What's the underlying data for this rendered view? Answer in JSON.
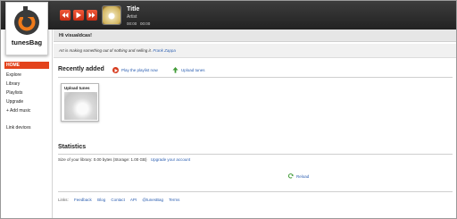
{
  "app": {
    "name": "tunesBag"
  },
  "player": {
    "title": "Title",
    "artist": "Artist",
    "time_elapsed": "00:00",
    "time_total": "00:00",
    "controls": [
      "previous",
      "play",
      "next"
    ]
  },
  "sidebar": {
    "items": [
      {
        "label": "HOME",
        "active": true
      },
      {
        "label": "Explore"
      },
      {
        "label": "Library"
      },
      {
        "label": "Playlists"
      },
      {
        "label": "Upgrade"
      },
      {
        "label": "+ Add music"
      },
      {
        "label": "Link devices"
      }
    ]
  },
  "greeting": "Hi visualdcas!",
  "quote": {
    "text": "Art is making something out of nothing and selling it.",
    "author": "Frank Zappa"
  },
  "recent": {
    "title": "Recently added",
    "play_label": "Play the playlist now",
    "upload_label": "Upload tunes",
    "card_label": "Upload tunes"
  },
  "statistics": {
    "title": "Statistics",
    "size_text": "Size of your library: 0.00 bytes (Storage: 1.00 GB)",
    "upgrade_label": "Upgrade your account",
    "reload_label": "Reload"
  },
  "footer": {
    "prefix": "Links:",
    "links": [
      "Feedback",
      "Blog",
      "Contact",
      "API",
      "@tunesBag",
      "Terms"
    ]
  },
  "colors": {
    "accent": "#e3431c",
    "link": "#2a5db0",
    "topbar": "#2e2e2e"
  }
}
